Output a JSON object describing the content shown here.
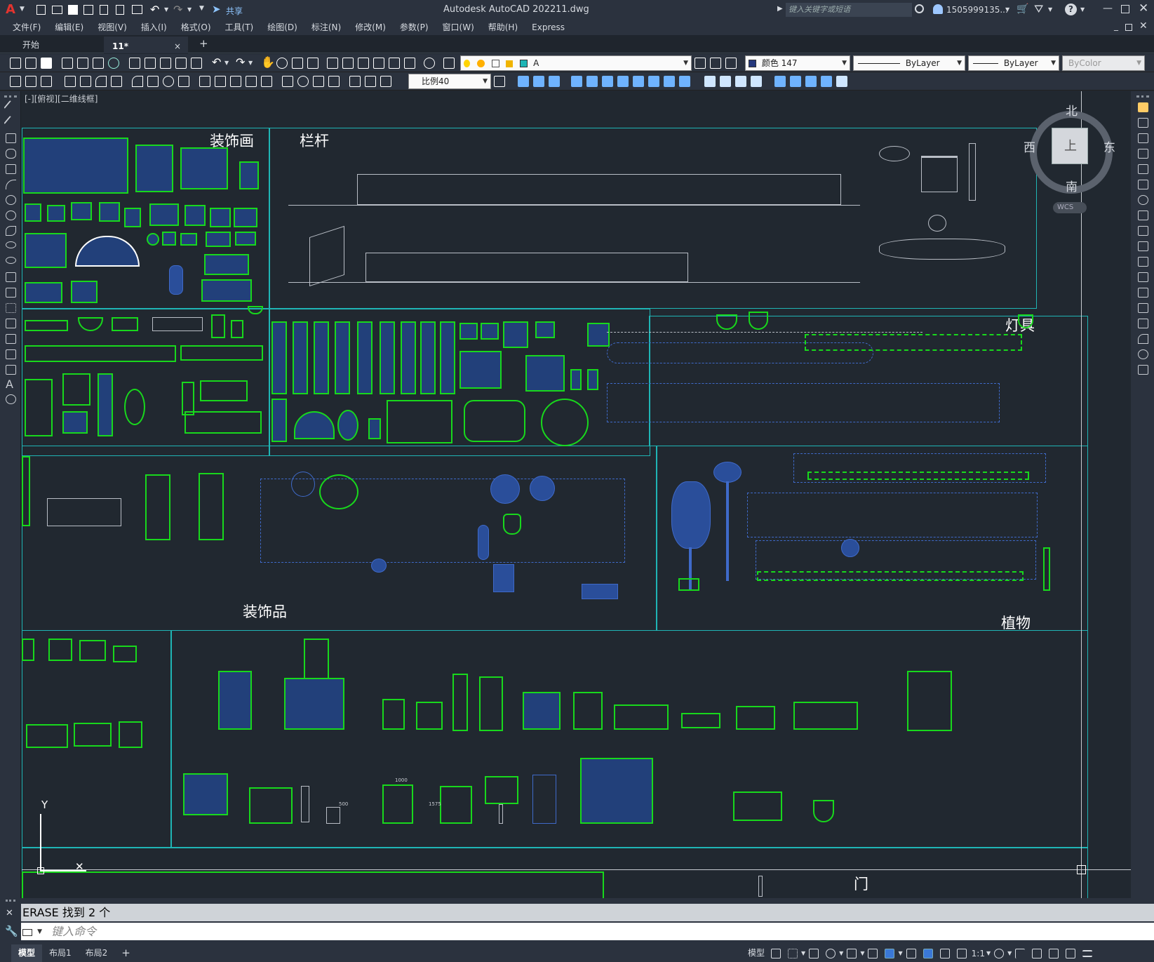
{
  "titlebar": {
    "app_letter": "A",
    "share_label": "共享",
    "title": "Autodesk AutoCAD 2022",
    "filename": "11.dwg",
    "search_placeholder": "键入关键字或短语",
    "user": "1505999135...",
    "help": "?"
  },
  "menu": [
    "文件(F)",
    "编辑(E)",
    "视图(V)",
    "插入(I)",
    "格式(O)",
    "工具(T)",
    "绘图(D)",
    "标注(N)",
    "修改(M)",
    "参数(P)",
    "窗口(W)",
    "帮助(H)",
    "Express"
  ],
  "tabs": {
    "start": "开始",
    "active": "11*",
    "close": "×",
    "add": "+"
  },
  "toolbar": {
    "layer": "A",
    "color": "颜色 147",
    "linetype": "ByLayer",
    "lineweight": "ByLayer",
    "plotstyle": "ByColor",
    "scale": "比例40"
  },
  "canvas": {
    "view_label": "[-][俯视][二维线框]",
    "viewcube": {
      "north": "北",
      "south": "南",
      "east": "东",
      "west": "西",
      "top": "上",
      "wcs": "WCS"
    },
    "ucs_y": "Y",
    "labels": {
      "decor_paintings": "装饰画",
      "railings": "栏杆",
      "lamps": "灯具",
      "ornaments": "装饰品",
      "plants": "植物",
      "door": "门"
    },
    "dims": [
      "1000",
      "500",
      "1575"
    ]
  },
  "command": {
    "history": "ERASE  找到  2  个",
    "placeholder": "键入命令"
  },
  "status": {
    "model_tab": "模型",
    "layout1": "布局1",
    "layout2": "布局2",
    "add": "+",
    "model_btn": "模型",
    "scale": "1:1"
  },
  "colors": {
    "bg": "#212830",
    "frame": "#1fb5b5",
    "green": "#18d81c",
    "blue": "#2a4e9a",
    "ui": "#2b323e"
  }
}
